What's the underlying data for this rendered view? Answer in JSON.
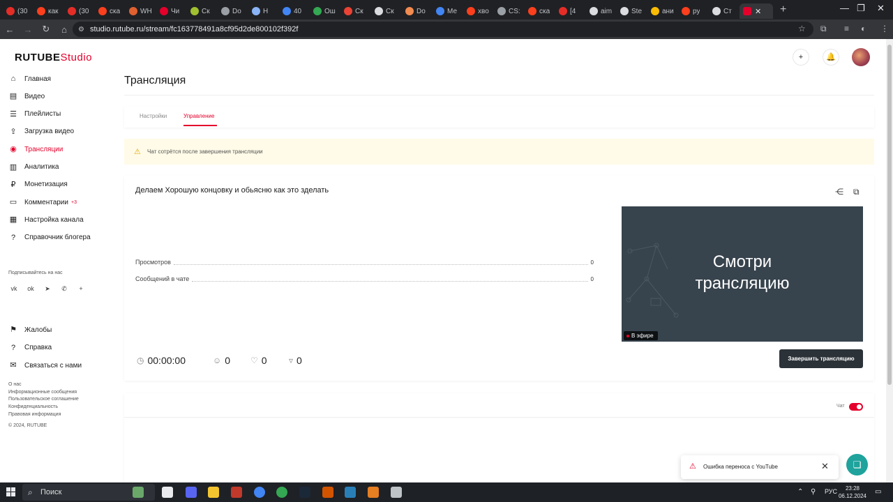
{
  "browser": {
    "tabs": [
      {
        "title": "(30",
        "color": "#e52d27"
      },
      {
        "title": "как",
        "color": "#fc3f1d"
      },
      {
        "title": "(30",
        "color": "#e52d27"
      },
      {
        "title": "ска",
        "color": "#fc3f1d"
      },
      {
        "title": "WH",
        "color": "#e06030"
      },
      {
        "title": "Чи",
        "color": "#e4002b"
      },
      {
        "title": "Ск",
        "color": "#a0c030"
      },
      {
        "title": "Do",
        "color": "#9aa0a6"
      },
      {
        "title": "Н",
        "color": "#8ab4f8"
      },
      {
        "title": "40",
        "color": "#4285f4"
      },
      {
        "title": "Ош",
        "color": "#34a853"
      },
      {
        "title": "Ск",
        "color": "#ea4335"
      },
      {
        "title": "Ск",
        "color": "#dadce0"
      },
      {
        "title": "Do",
        "color": "#f28b50"
      },
      {
        "title": "Ме",
        "color": "#4285f4"
      },
      {
        "title": "хво",
        "color": "#fc3f1d"
      },
      {
        "title": "CS:",
        "color": "#9aa0a6"
      },
      {
        "title": "ска",
        "color": "#fc3f1d"
      },
      {
        "title": "[4",
        "color": "#e52d27"
      },
      {
        "title": "aim",
        "color": "#dadce0"
      },
      {
        "title": "Ste",
        "color": "#dadce0"
      },
      {
        "title": "ани",
        "color": "#fbbc04"
      },
      {
        "title": "ру",
        "color": "#fc3f1d"
      },
      {
        "title": "Ст",
        "color": "#dadce0"
      }
    ],
    "active_tab": {
      "title": "",
      "color": "#e4002b"
    },
    "close_glyph": "✕",
    "new_tab_glyph": "+",
    "url": "studio.rutube.ru/stream/fc163778491a8cf95d2de800102f392f"
  },
  "sidebar": {
    "logo_main": "RUTUBE",
    "logo_sub": "Studio",
    "items": [
      {
        "label": "Главная",
        "icon": "home-icon",
        "glyph": "⌂"
      },
      {
        "label": "Видео",
        "icon": "video-icon",
        "glyph": "▤"
      },
      {
        "label": "Плейлисты",
        "icon": "playlist-icon",
        "glyph": "☰"
      },
      {
        "label": "Загрузка видео",
        "icon": "upload-icon",
        "glyph": "⇪"
      },
      {
        "label": "Трансляции",
        "icon": "broadcast-icon",
        "glyph": "◉"
      },
      {
        "label": "Аналитика",
        "icon": "analytics-icon",
        "glyph": "▥"
      },
      {
        "label": "Монетизация",
        "icon": "monetization-icon",
        "glyph": "₽"
      },
      {
        "label": "Комментарии",
        "icon": "comments-icon",
        "glyph": "▭",
        "badge": "+3"
      },
      {
        "label": "Настройка канала",
        "icon": "channel-settings-icon",
        "glyph": "▦"
      },
      {
        "label": "Справочник блогера",
        "icon": "guide-icon",
        "glyph": "?"
      }
    ],
    "follow_label": "Подписывайтесь на нас",
    "socials": [
      {
        "icon": "vk-icon",
        "glyph": "vk"
      },
      {
        "icon": "ok-icon",
        "glyph": "ok"
      },
      {
        "icon": "telegram-icon",
        "glyph": "➤"
      },
      {
        "icon": "viber-icon",
        "glyph": "✆"
      },
      {
        "icon": "more-icon",
        "glyph": "+"
      }
    ],
    "bottom_items": [
      {
        "label": "Жалобы",
        "icon": "flag-icon",
        "glyph": "⚑"
      },
      {
        "label": "Справка",
        "icon": "help-icon",
        "glyph": "?"
      },
      {
        "label": "Связаться с нами",
        "icon": "mail-icon",
        "glyph": "✉"
      }
    ],
    "footer_links": [
      "О нас",
      "Информационные сообщения",
      "Пользовательское соглашение",
      "Конфиденциальность",
      "Правовая информация"
    ],
    "copyright": "© 2024, RUTUBE"
  },
  "header": {
    "icons": [
      {
        "icon": "add-icon",
        "glyph": "+"
      },
      {
        "icon": "notifications-icon",
        "glyph": "🔔"
      }
    ]
  },
  "page": {
    "title": "Трансляция",
    "tabs": [
      "Настройки",
      "Управление"
    ],
    "active_tab": "Управление",
    "warning": "Чат сотрётся после завершения трансляции"
  },
  "stream": {
    "title": "Делаем Хорошую концовку и обьясню как это зделать",
    "stats": [
      {
        "label": "Просмотров",
        "value": "0"
      },
      {
        "label": "Сообщений в чате",
        "value": "0"
      }
    ],
    "preview_text_line1": "Смотри",
    "preview_text_line2": "трансляцию",
    "live_label": "В эфире",
    "metrics": [
      {
        "icon": "clock-icon",
        "glyph": "◷",
        "value": "00:00:00"
      },
      {
        "icon": "viewers-icon",
        "glyph": "☺",
        "value": "0"
      },
      {
        "icon": "like-icon",
        "glyph": "👍",
        "value": "0"
      },
      {
        "icon": "dislike-icon",
        "glyph": "👎",
        "value": "0"
      }
    ],
    "end_button": "Завершить трансляцию"
  },
  "chat": {
    "label": "Чат",
    "enabled": true
  },
  "toast": {
    "message": "Ошибка переноса с YouTube"
  },
  "taskbar": {
    "search_placeholder": "Поиск",
    "apps": [
      {
        "icon": "city-icon",
        "color": "#6aa86a"
      },
      {
        "icon": "task-view-icon",
        "color": "#e8eaed"
      },
      {
        "icon": "discord-icon",
        "color": "#5865f2"
      },
      {
        "icon": "explorer-icon",
        "color": "#f4c430"
      },
      {
        "icon": "app-icon",
        "color": "#c0392b"
      },
      {
        "icon": "chrome-icon",
        "color": "#4285f4"
      },
      {
        "icon": "chrome-alt-icon",
        "color": "#34a853"
      },
      {
        "icon": "steam-icon",
        "color": "#1b2838"
      },
      {
        "icon": "archive-icon",
        "color": "#d35400"
      },
      {
        "icon": "window-icon",
        "color": "#2980b9"
      },
      {
        "icon": "game-icon",
        "color": "#e67e22"
      },
      {
        "icon": "obs-icon",
        "color": "#bdc3c7"
      }
    ],
    "language": "РУС",
    "time": "23:28",
    "date": "06.12.2024"
  }
}
